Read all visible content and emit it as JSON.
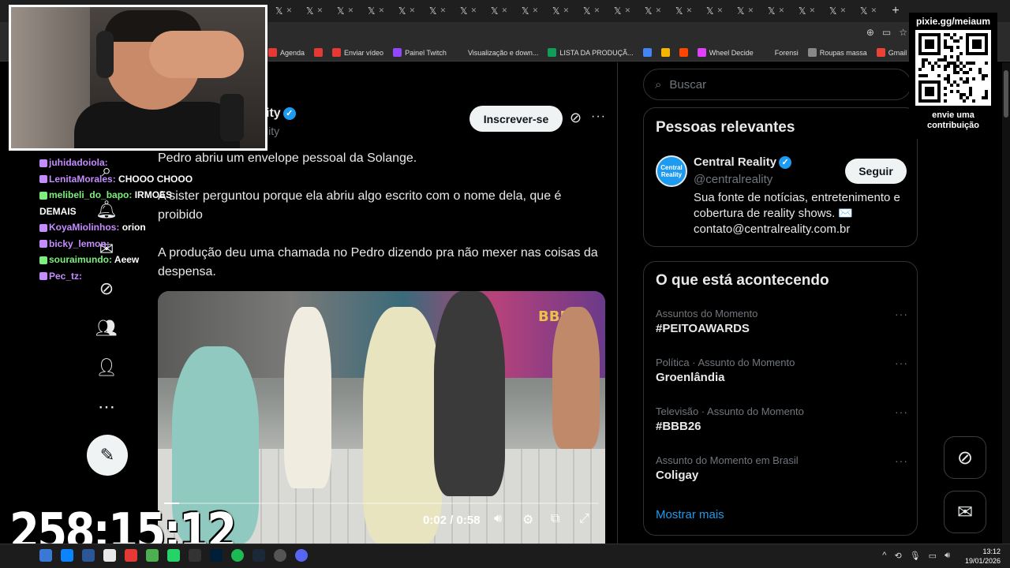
{
  "browser": {
    "tabs_count": 20,
    "tab_icon": "x-icon",
    "new_tab_label": "+",
    "bookmarks": [
      {
        "label": "Agenda",
        "color": "#e53935"
      },
      {
        "label": "",
        "color": "#e53935"
      },
      {
        "label": "Enviar vídeo",
        "color": "#e53935"
      },
      {
        "label": "Painel Twitch",
        "color": "#9146ff"
      },
      {
        "label": "Visualização e down...",
        "color": ""
      },
      {
        "label": "LISTA DA PRODUÇÃ...",
        "color": "#0f9d58"
      },
      {
        "label": "",
        "color": "#4285f4"
      },
      {
        "label": "",
        "color": "#f4b400"
      },
      {
        "label": "",
        "color": "#ff4500"
      },
      {
        "label": "Wheel Decide",
        "color": "#e040fb"
      },
      {
        "label": "Forensi",
        "color": ""
      },
      {
        "label": "Roupas massa",
        "color": "#888888"
      },
      {
        "label": "Gmail",
        "color": "#ea4335"
      }
    ]
  },
  "main": {
    "account_name": "ity",
    "account_handle": "lity",
    "subscribe_label": "Inscrever-se",
    "paragraphs": [
      "Pedro abriu um envelope pessoal da Solange.",
      "A sister perguntou porque ela abriu algo escrito com o nome dela, que é proibido",
      "A produção deu uma chamada no Pedro dizendo pra não mexer nas coisas da despensa."
    ],
    "video": {
      "brand_text": "BBB",
      "time_label": "0:02 / 0:58",
      "progress": 0.034
    }
  },
  "sidebar": {
    "search_placeholder": "Buscar",
    "relevant_title": "Pessoas relevantes",
    "relevant_person": {
      "avatar_text": "Central Reality",
      "name": "Central Reality",
      "handle": "@centralreality",
      "bio": "Sua fonte de notícias, entretenimento e cobertura de reality shows. ✉️ contato@centralreality.com.br",
      "follow_label": "Seguir"
    },
    "trends_title": "O que está acontecendo",
    "trends": [
      {
        "meta": "Assuntos do Momento",
        "name": "#PEITOAWARDS"
      },
      {
        "meta": "Política · Assunto do Momento",
        "name": "Groenlândia"
      },
      {
        "meta": "Televisão · Assunto do Momento",
        "name": "#BBB26"
      },
      {
        "meta": "Assunto do Momento em Brasil",
        "name": "Coligay"
      }
    ],
    "show_more": "Mostrar mais"
  },
  "overlay": {
    "chat": [
      {
        "user": "juhidadoiola",
        "color": "#c58cff",
        "message": ""
      },
      {
        "user": "LenitaMorales",
        "color": "#c58cff",
        "message": "CHOOO CHOOO"
      },
      {
        "user": "melibeli_do_bapo",
        "color": "#7cf07c",
        "message": "IRMOES"
      },
      {
        "user": "",
        "color": "#ffffff",
        "message": "DEMAIS"
      },
      {
        "user": "KoyaMiolinhos",
        "color": "#c58cff",
        "message": "orion"
      },
      {
        "user": "bicky_lemon",
        "color": "#c58cff",
        "message": ""
      },
      {
        "user": "souraimundo",
        "color": "#7cf07c",
        "message": "Aeew"
      },
      {
        "user": "Pec_tz",
        "color": "#c58cff",
        "message": ""
      }
    ],
    "qr_title": "pixie.gg/meiaum",
    "qr_subtitle": "envie uma contribuição",
    "timer": "258:15:12"
  },
  "taskbar": {
    "time": "13:12",
    "date": "19/01/2026",
    "tray_chevron": "^"
  }
}
